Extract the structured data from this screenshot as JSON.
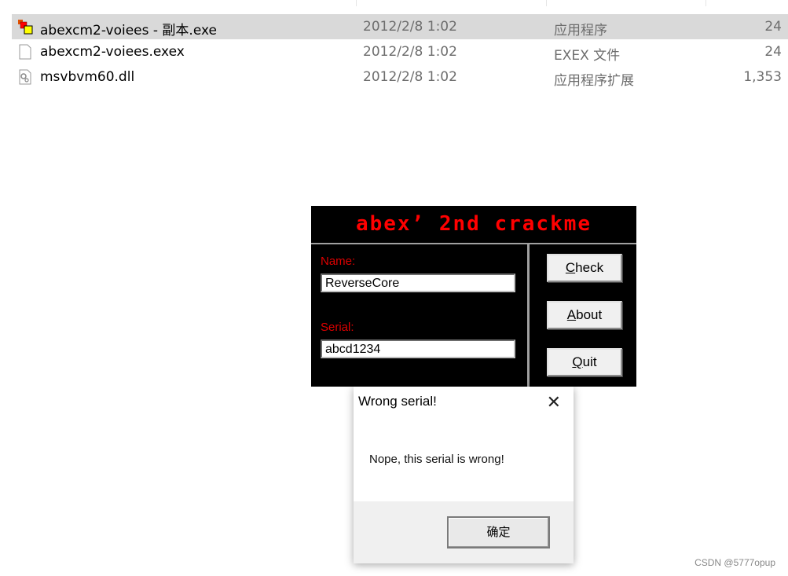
{
  "files": [
    {
      "name": "abexcm2-voiees - 副本.exe",
      "date": "2012/2/8 1:02",
      "type": "应用程序",
      "size": "24",
      "icon": "vb-app-icon",
      "selected": true
    },
    {
      "name": "abexcm2-voiees.exex",
      "date": "2012/2/8 1:02",
      "type": "EXEX 文件",
      "size": "24",
      "icon": "blank-file-icon",
      "selected": false
    },
    {
      "name": "msvbvm60.dll",
      "date": "2012/2/8 1:02",
      "type": "应用程序扩展",
      "size": "1,353",
      "icon": "dll-gear-icon",
      "selected": false
    }
  ],
  "crackme": {
    "title": "abex’ 2nd crackme",
    "name_label": "Name:",
    "name_value": "ReverseCore",
    "serial_label": "Serial:",
    "serial_value": "abcd1234",
    "check_first": "C",
    "check_rest": "heck",
    "about_first": "A",
    "about_rest": "bout",
    "quit_first": "Q",
    "quit_rest": "uit",
    "accent": "#ff0000"
  },
  "dialog": {
    "title": "Wrong serial!",
    "message": "Nope, this serial is wrong!",
    "ok": "确定",
    "close": "✕"
  },
  "watermark": "CSDN @5777opup"
}
